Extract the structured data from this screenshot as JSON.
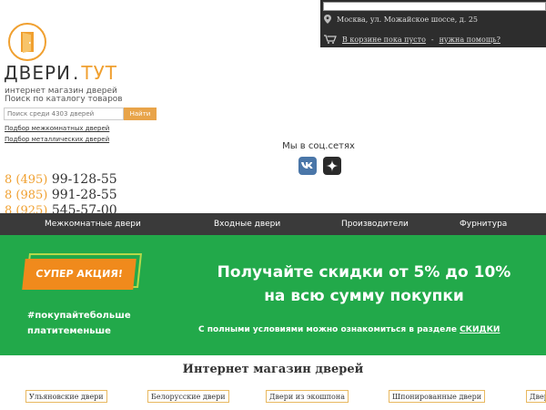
{
  "topbar": {
    "address": "Москва, ул. Можайское шоссе, д. 25",
    "cart_empty": "В корзине пока пусто",
    "separator": "-",
    "help_link": "нужна помощь?"
  },
  "logo": {
    "name_main": "ДВЕРИ",
    "name_dot": ".",
    "name_accent": "ТУТ",
    "tagline": "интернет магазин дверей"
  },
  "search": {
    "title": "Поиск по каталогу товаров",
    "placeholder": "Поиск среди 4303 дверей",
    "button": "Найти"
  },
  "filters": [
    "Подбор межкомнатных дверей",
    "Подбор металлических дверей"
  ],
  "phones": [
    {
      "code": "8 (495)",
      "number": "99-128-55"
    },
    {
      "code": "8 (985)",
      "number": "991-28-55"
    },
    {
      "code": "8 (925)",
      "number": "545-57-00"
    }
  ],
  "social": {
    "title": "Мы в соц.сетях",
    "vk_color": "#4a76a8",
    "other_color": "#2b2b2b"
  },
  "nav": [
    "Межкомнатные двери",
    "Входные двери",
    "Производители",
    "Фурнитура"
  ],
  "banner": {
    "badge": "СУПЕР АКЦИЯ!",
    "hashtag_line1": "#покупайтебольше",
    "hashtag_line2": "платитеменьше",
    "title_line1": "Получайте скидки от 5% до 10%",
    "title_line2": "на всю сумму покупки",
    "note": "С полными условиями можно ознакомиться в разделе",
    "note_link": "СКИДКИ",
    "bg_color": "#22a94a",
    "badge_color": "#f08a1c"
  },
  "section_title": "Интернет магазин дверей",
  "categories": [
    "Ульяновские двери",
    "Белорусские двери",
    "Двери из экошпона",
    "Шпонированные двери",
    "Двери"
  ]
}
